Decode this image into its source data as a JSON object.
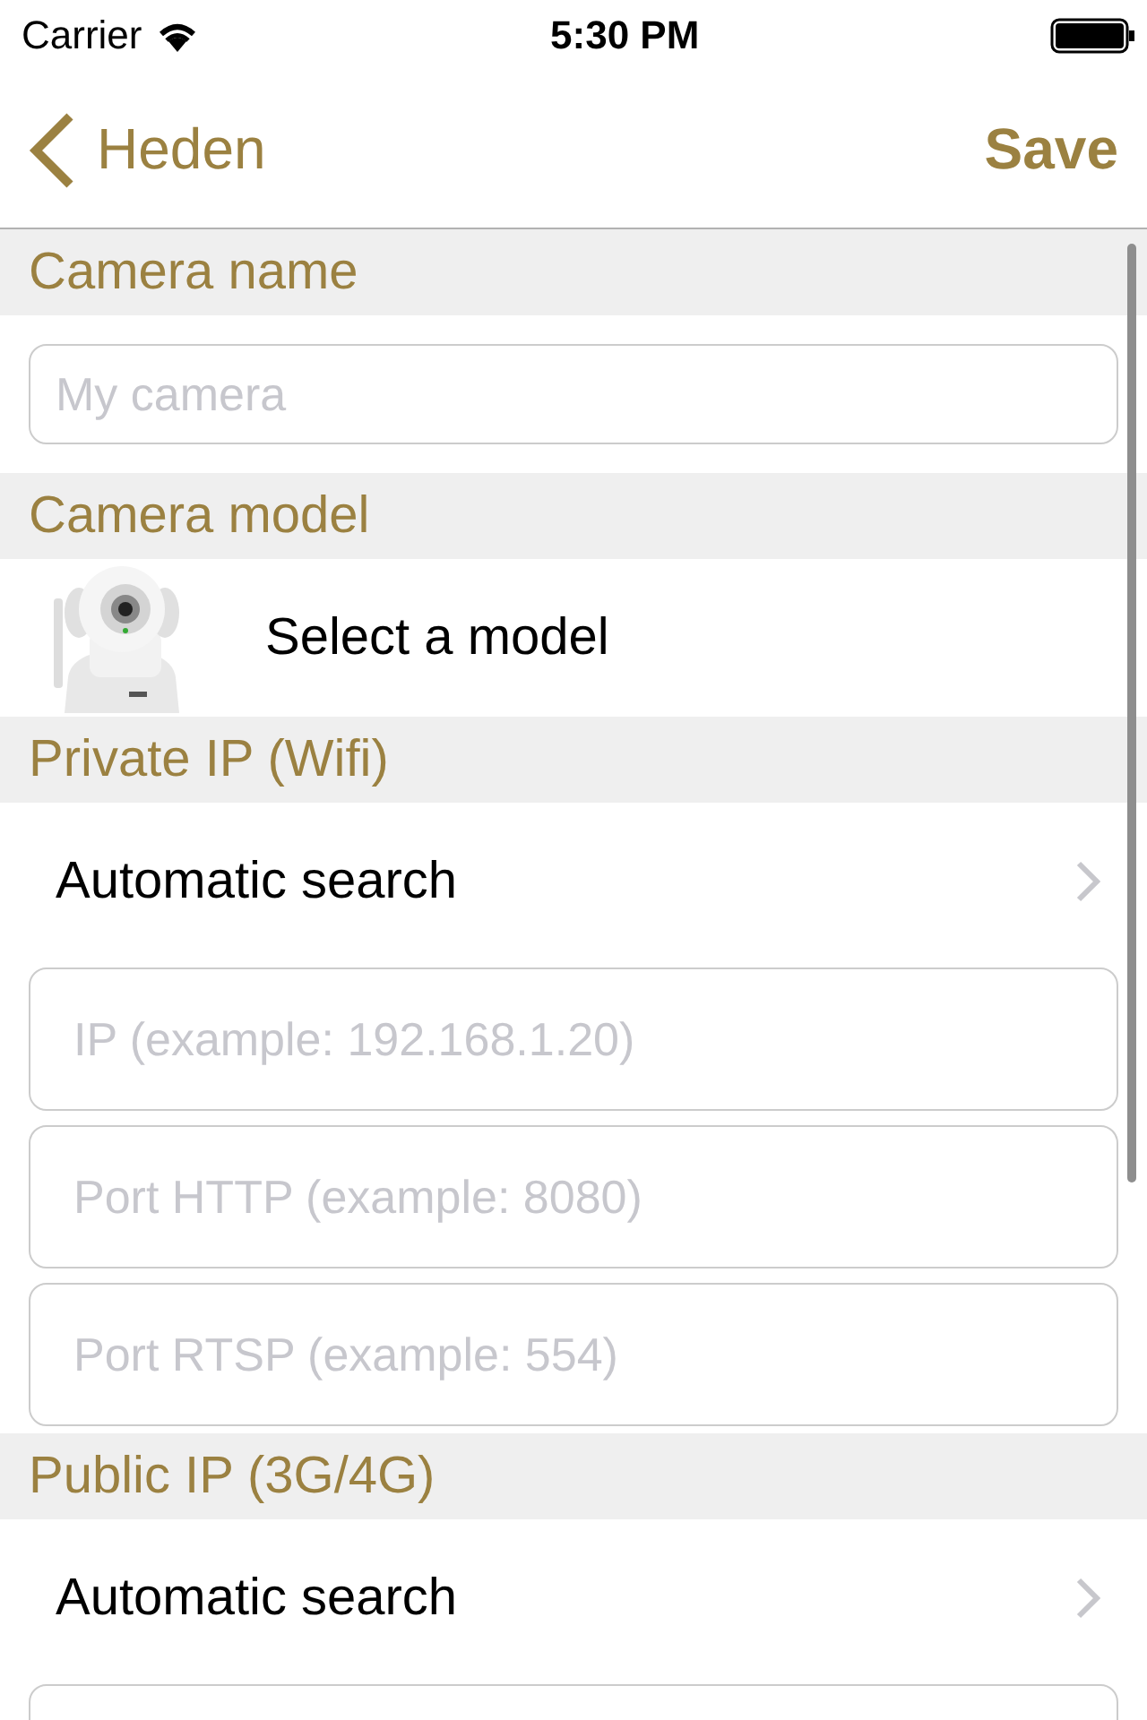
{
  "status_bar": {
    "carrier": "Carrier",
    "time": "5:30 PM"
  },
  "nav": {
    "back": "Heden",
    "action": "Save"
  },
  "sections": [
    {
      "title": "Camera name",
      "items": [
        {
          "kind": "field",
          "placeholder": "My camera"
        }
      ]
    },
    {
      "title": "Camera model",
      "items": [
        {
          "kind": "model",
          "label": "Select a model"
        }
      ]
    },
    {
      "title": "Private IP (Wifi)",
      "items": [
        {
          "kind": "link",
          "label": "Automatic search"
        },
        {
          "kind": "field",
          "placeholder": "IP (example: 192.168.1.20)"
        },
        {
          "kind": "field",
          "placeholder": "Port HTTP (example: 8080)"
        },
        {
          "kind": "field",
          "placeholder": "Port RTSP (example: 554)"
        }
      ]
    },
    {
      "title": "Public IP (3G/4G)",
      "items": [
        {
          "kind": "link",
          "label": "Automatic search"
        },
        {
          "kind": "field"
        }
      ]
    }
  ]
}
